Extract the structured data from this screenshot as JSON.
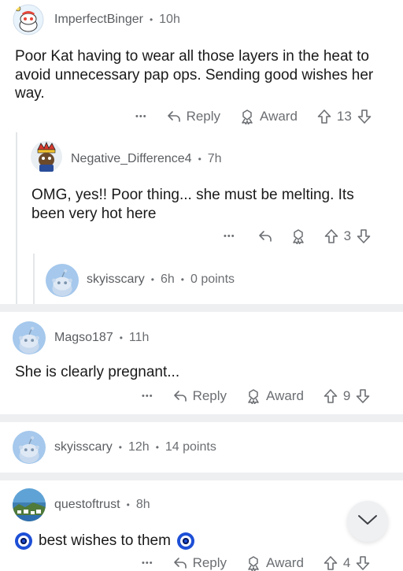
{
  "comments": [
    {
      "user": "ImperfectBinger",
      "age": "10h",
      "text": "Poor Kat having to wear all those layers in the heat to avoid unnecessary pap ops. Sending good wishes her way.",
      "reply_label": "Reply",
      "award_label": "Award",
      "votes": "13"
    },
    {
      "user": "Negative_Difference4",
      "age": "7h",
      "text": "OMG, yes!! Poor thing... she must be melting. Its been very hot here",
      "votes": "3"
    },
    {
      "user": "skyisscary",
      "age": "6h",
      "points": "0 points"
    },
    {
      "user": "Magso187",
      "age": "11h",
      "text": "She is clearly pregnant...",
      "reply_label": "Reply",
      "award_label": "Award",
      "votes": "9"
    },
    {
      "user": "skyisscary",
      "age": "12h",
      "points": "14 points"
    },
    {
      "user": "questoftrust",
      "age": "8h",
      "text": "best wishes to them",
      "reply_label": "Reply",
      "award_label": "Award",
      "votes": "4"
    }
  ],
  "more_label": "•••",
  "dot": "•",
  "colors": {
    "snoo_bg": "#a5c8ec",
    "separator": "#edeff1",
    "eye_blue": "#1d4fd6"
  },
  "icons": [
    "more-icon",
    "reply-icon",
    "award-icon",
    "upvote-icon",
    "downvote-icon",
    "chevron-down-icon",
    "nazar-eye-icon"
  ]
}
